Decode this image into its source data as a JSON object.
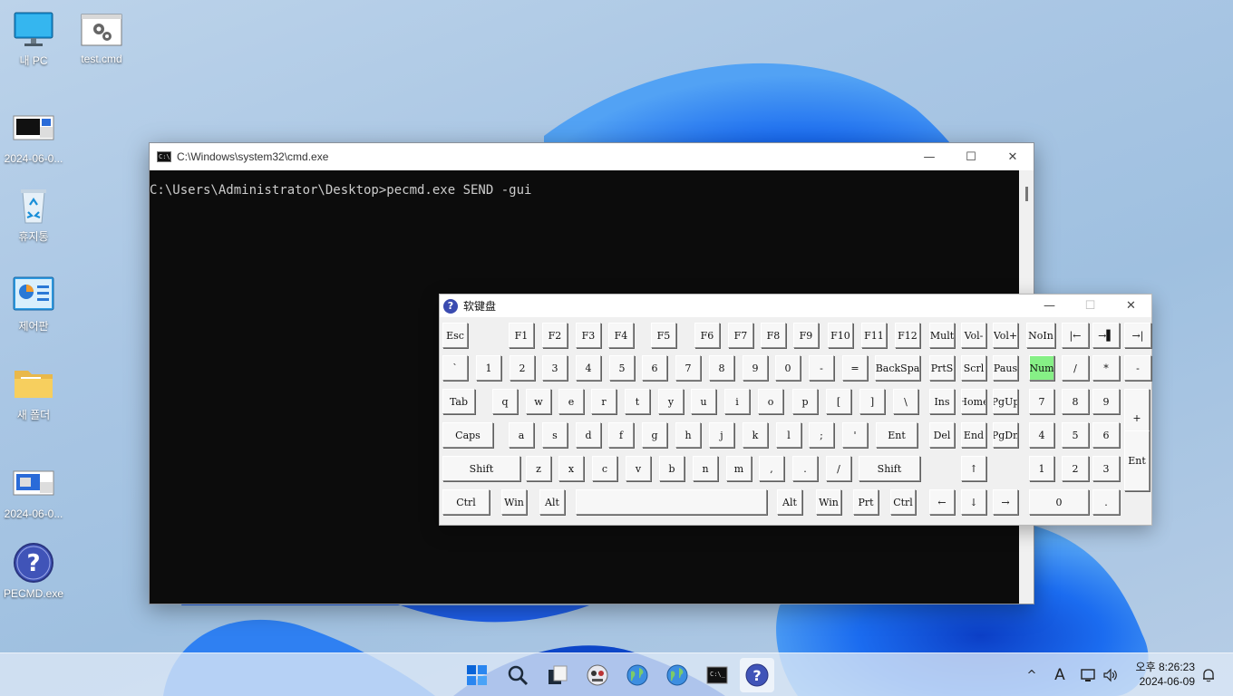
{
  "desktop": {
    "icons": [
      {
        "label": "내 PC",
        "icon": "monitor-icon"
      },
      {
        "label": "test.cmd",
        "icon": "settings-script-icon"
      },
      {
        "label": "2024-06-0...",
        "icon": "screenshot-file-icon"
      },
      {
        "label": "휴지통",
        "icon": "recycle-bin-icon"
      },
      {
        "label": "제어판",
        "icon": "control-panel-icon"
      },
      {
        "label": "새 폴더",
        "icon": "folder-icon"
      },
      {
        "label": "2024-06-0...",
        "icon": "screenshot-file-icon"
      },
      {
        "label": "PECMD.exe",
        "icon": "help-icon"
      }
    ]
  },
  "cmd_window": {
    "title": "C:\\Windows\\system32\\cmd.exe",
    "console_text": "C:\\Users\\Administrator\\Desktop>pecmd.exe SEND -gui",
    "buttons": {
      "minimize": "—",
      "maximize": "☐",
      "close": "✕"
    }
  },
  "keyboard_window": {
    "title": "软键盘",
    "buttons": {
      "minimize": "—",
      "maximize": "☐",
      "close": "✕"
    },
    "keys": {
      "row1": [
        "Esc",
        "F1",
        "F2",
        "F3",
        "F4",
        "F5",
        "F6",
        "F7",
        "F8",
        "F9",
        "F10",
        "F11",
        "F12",
        "Mult",
        "Vol-",
        "Vol+",
        "NoIn",
        "|←",
        "→▌",
        "→|"
      ],
      "row2": [
        "`",
        "1",
        "2",
        "3",
        "4",
        "5",
        "6",
        "7",
        "8",
        "9",
        "0",
        "-",
        "=",
        "BackSpa",
        "PrtS",
        "Scrl",
        "Paus",
        "Num",
        "/",
        "*",
        "-"
      ],
      "row3": [
        "Tab",
        "q",
        "w",
        "e",
        "r",
        "t",
        "y",
        "u",
        "i",
        "o",
        "p",
        "[",
        "]",
        "\\",
        "Ins",
        "Home",
        "PgUp",
        "7",
        "8",
        "9",
        "+"
      ],
      "row4": [
        "Caps",
        "a",
        "s",
        "d",
        "f",
        "g",
        "h",
        "j",
        "k",
        "l",
        ";",
        "'",
        "Ent",
        "Del",
        "End",
        "PgDn",
        "4",
        "5",
        "6"
      ],
      "row5": [
        "Shift",
        "z",
        "x",
        "c",
        "v",
        "b",
        "n",
        "m",
        ",",
        ".",
        "/",
        "Shift",
        "↑",
        "1",
        "2",
        "3",
        "Ent"
      ],
      "row6": [
        "Ctrl",
        "Win",
        "Alt",
        "",
        "Alt",
        "Win",
        "Prt",
        "Ctrl",
        "←",
        "↓",
        "→",
        "0",
        "."
      ]
    },
    "active_key": "Num",
    "active_color": "#86f086"
  },
  "taskbar": {
    "apps": [
      "start-icon",
      "search-icon",
      "task-view-icon",
      "app-icon",
      "globe-icon",
      "globe-icon",
      "terminal-icon",
      "help-icon"
    ],
    "tray": {
      "chevron": "^",
      "ime": "A"
    },
    "clock_time": "오후 8:26:23",
    "clock_date": "2024-06-09"
  },
  "colors": {
    "accent": "#0a64d8",
    "console_bg": "#0c0c0c",
    "console_fg": "#cccccc"
  }
}
